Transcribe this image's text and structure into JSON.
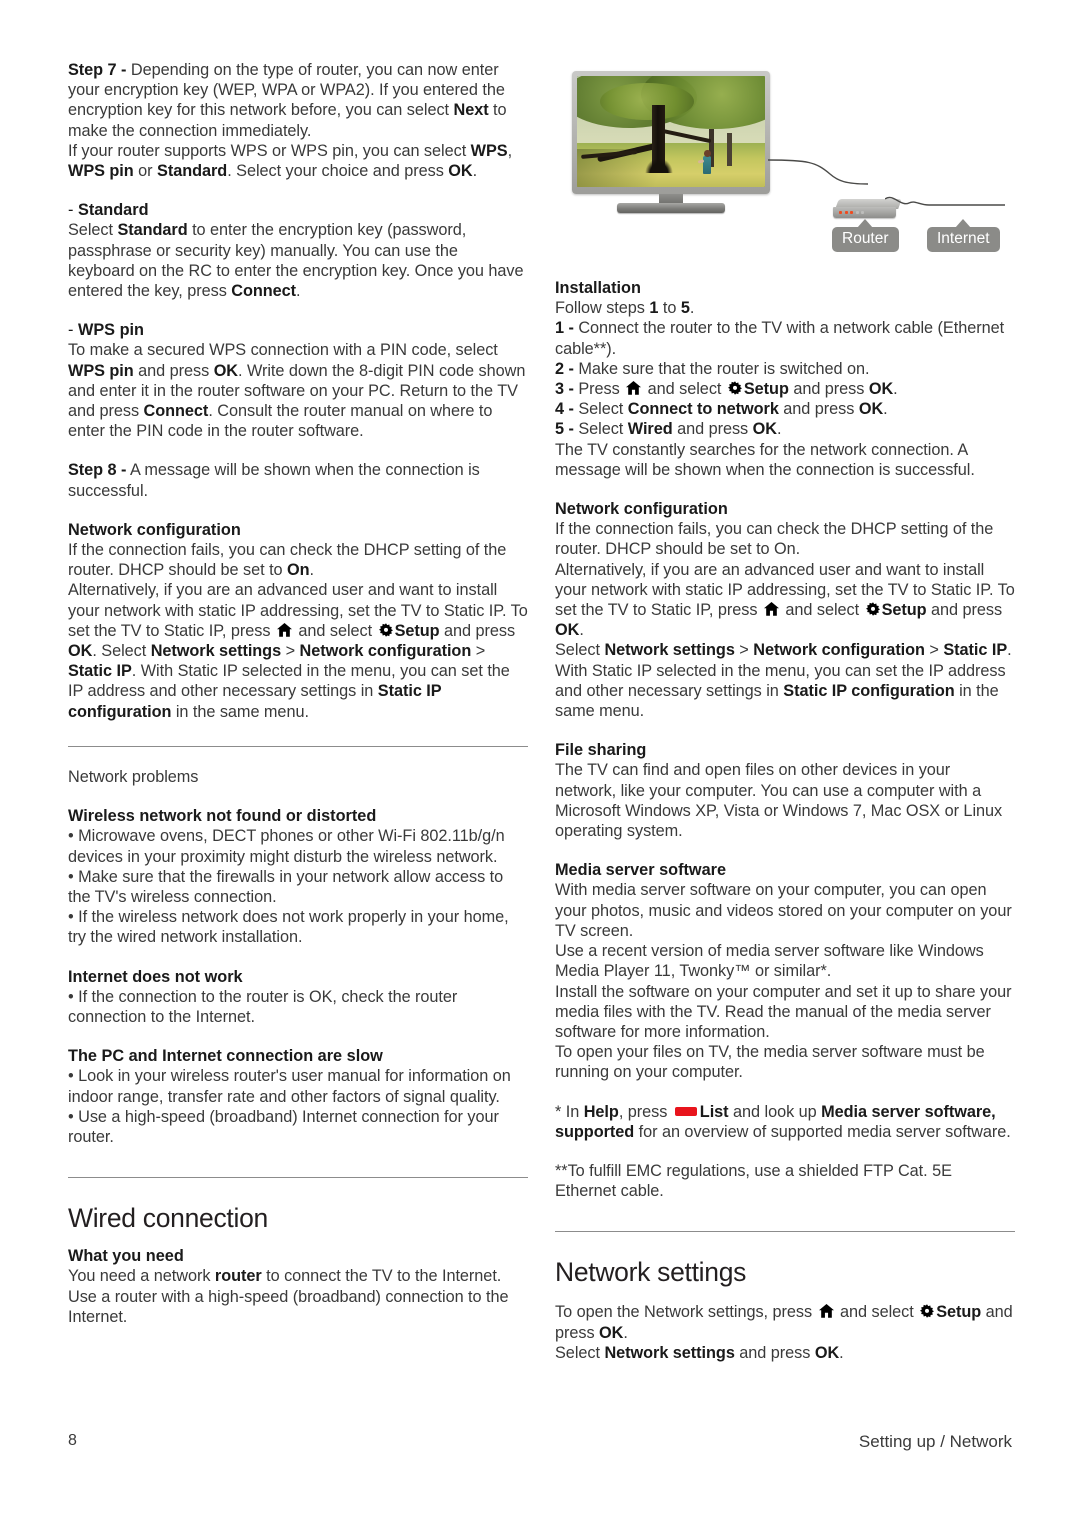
{
  "document": {
    "footer": {
      "page_number": "8",
      "running_head": "Setting up / Network"
    }
  },
  "left_column": {
    "step7": {
      "label": "Step 7 -",
      "t1": " Depending on the type of router, you can now enter your encryption key (WEP, WPA or WPA2). If you entered the encryption key for this network before, you can select ",
      "b1": "Next",
      "t2": " to make the connection immediately.",
      "t3": "If your router supports WPS or WPS pin, you can select ",
      "b2": "WPS",
      "t4": ", ",
      "b3": "WPS pin",
      "t5": " or ",
      "b4": "Standard",
      "t6": ". Select your choice and press ",
      "b5": "OK",
      "t7": "."
    },
    "standard": {
      "heading_dash": "- ",
      "heading": "Standard",
      "t1": "Select ",
      "b1": "Standard",
      "t2": " to enter the encryption key (password, passphrase or security key) manually. You can use the keyboard on the RC to enter the encryption key. Once you have entered the key, press ",
      "b2": "Connect",
      "t3": "."
    },
    "wps_pin": {
      "heading_dash": "- ",
      "heading": "WPS pin",
      "t1": "To make a secured WPS connection with a PIN code, select ",
      "b1": "WPS pin",
      "t2": " and press ",
      "b2": "OK",
      "t3": ". Write down the 8-digit PIN code shown and enter it in the router software on your PC. Return to the TV and press ",
      "b3": "Connect",
      "t4": ". Consult the router manual on where to enter the PIN code in the router software."
    },
    "step8": {
      "label": "Step 8 -",
      "t1": " A message will be shown when the connection is successful."
    },
    "network_configuration": {
      "heading": "Network configuration",
      "t1": "If the connection fails, you can check the DHCP setting of the router. DHCP should be set to ",
      "b1": "On",
      "t2": ".",
      "t3": "Alternatively, if you are an advanced user and want to install your network with static IP addressing, set the TV to Static IP. To set the TV to Static IP, press ",
      "icon_home": "home-icon",
      "t4": " and select ",
      "icon_gear": "gear-icon",
      "b2": "Setup",
      "t5": " and press ",
      "b3": "OK",
      "t6": ". Select ",
      "b4": "Network settings",
      "t7": " > ",
      "b5": "Network configuration",
      "t8": " > ",
      "b6": "Static IP",
      "t9": ". With Static IP selected in the menu, you can set the IP address and other necessary settings in ",
      "b7": "Static IP configuration",
      "t10": " in the same menu."
    },
    "network_problems": {
      "heading": "Network problems",
      "wireless": {
        "heading": "Wireless network not found or distorted",
        "bullets": [
          "Microwave ovens, DECT phones or other Wi-Fi 802.11b/g/n devices in your proximity might disturb the wireless network.",
          "Make sure that the firewalls in your network allow access to the TV's wireless connection.",
          "If the wireless network does not work properly in your home, try the wired network installation."
        ]
      },
      "internet": {
        "heading": "Internet does not work",
        "bullets": [
          "If the connection to the router is OK, check the router connection to the Internet."
        ]
      },
      "slow": {
        "heading": "The PC and Internet connection are slow",
        "bullets": [
          "Look in your wireless router's user manual for information on indoor range, transfer rate and other factors of signal quality.",
          "Use a high-speed (broadband) Internet connection for your router."
        ]
      }
    },
    "wired_connection": {
      "title": "Wired connection",
      "what_you_need": {
        "heading": "What you need",
        "t1": "You need a network ",
        "b1": "router",
        "t2": " to connect the TV to the Internet. Use a router with a high-speed (broadband) connection to the Internet."
      }
    }
  },
  "figure": {
    "tv_label": "tv-with-park-scene",
    "router_callout": "Router",
    "internet_callout": "Internet"
  },
  "right_column": {
    "installation": {
      "heading": "Installation",
      "intro_t1": "Follow steps ",
      "intro_b1": "1",
      "intro_t2": " to ",
      "intro_b2": "5",
      "intro_t3": ".",
      "steps": [
        {
          "num": "1 -",
          "t1": " Connect the router to the TV with a network cable (Ethernet cable**)."
        },
        {
          "num": "2 -",
          "t1": " Make sure that the router is switched on."
        },
        {
          "num": "3 -",
          "t1": " Press ",
          "icon_home": "home-icon",
          "t2": " and select ",
          "icon_gear": "gear-icon",
          "b1": "Setup",
          "t3": " and press ",
          "b2": "OK",
          "t4": "."
        },
        {
          "num": "4 -",
          "t1": " Select ",
          "b1": "Connect to network",
          "t2": " and press ",
          "b2": "OK",
          "t3": "."
        },
        {
          "num": "5 -",
          "t1": " Select ",
          "b1": "Wired",
          "t2": " and press ",
          "b2": "OK",
          "t3": "."
        }
      ],
      "outro": "The TV constantly searches for the network connection. A message will be shown when the connection is successful."
    },
    "network_configuration": {
      "heading": "Network configuration",
      "t1": "If the connection fails, you can check the DHCP setting of the router. DHCP should be set to On.",
      "t2": "Alternatively, if you are an advanced user and want to install your network with static IP addressing, set the TV to Static IP. To set the TV to Static IP, press ",
      "icon_home": "home-icon",
      "t3": " and select ",
      "icon_gear": "gear-icon",
      "b1": "Setup",
      "t4": " and press ",
      "b2": "OK",
      "t5": ".",
      "t6": "Select ",
      "b3": "Network settings",
      "t7": " > ",
      "b4": "Network configuration",
      "t8": " > ",
      "b5": "Static IP",
      "t9": ". With Static IP selected in the menu, you can set the IP address and other necessary settings in ",
      "b6": "Static IP configuration",
      "t10": " in the same menu."
    },
    "file_sharing": {
      "heading": "File sharing",
      "t1": "The TV can find and open files on other devices in your network, like your computer. You can use a computer with a Microsoft Windows XP, Vista or Windows 7, Mac OSX or Linux operating system."
    },
    "media_server_software": {
      "heading": "Media server software",
      "t1": "With media server software on your computer, you can open your photos, music and videos stored on your computer on your TV screen.",
      "t2": "Use a recent version of media server software like Windows Media Player 11, Twonky™ or similar*.",
      "t3": "Install the software on your computer and set it up to share your media files with the TV. Read the manual of the media server software for more information.",
      "t4": "To open your files on TV, the media server software must be running on your computer."
    },
    "footnote_star": {
      "t1": "* In ",
      "b1": "Help",
      "t2": ", press ",
      "icon_red_key": "red-key-icon",
      "b2": "List",
      "t3": " and look up ",
      "b3": "Media server software, supported",
      "t4": " for an overview of supported media server software."
    },
    "footnote_double_star": {
      "t1": "**To fulfill EMC regulations, use a shielded FTP Cat. 5E Ethernet cable."
    },
    "network_settings": {
      "title": "Network settings",
      "t1": "To open the Network settings, press ",
      "icon_home": "home-icon",
      "t2": " and select ",
      "icon_gear": "gear-icon",
      "b1": "Setup",
      "t3": " and press ",
      "b2": "OK",
      "t4": ".",
      "t5": "Select ",
      "b3": "Network settings",
      "t6": " and press ",
      "b4": "OK",
      "t7": "."
    }
  }
}
